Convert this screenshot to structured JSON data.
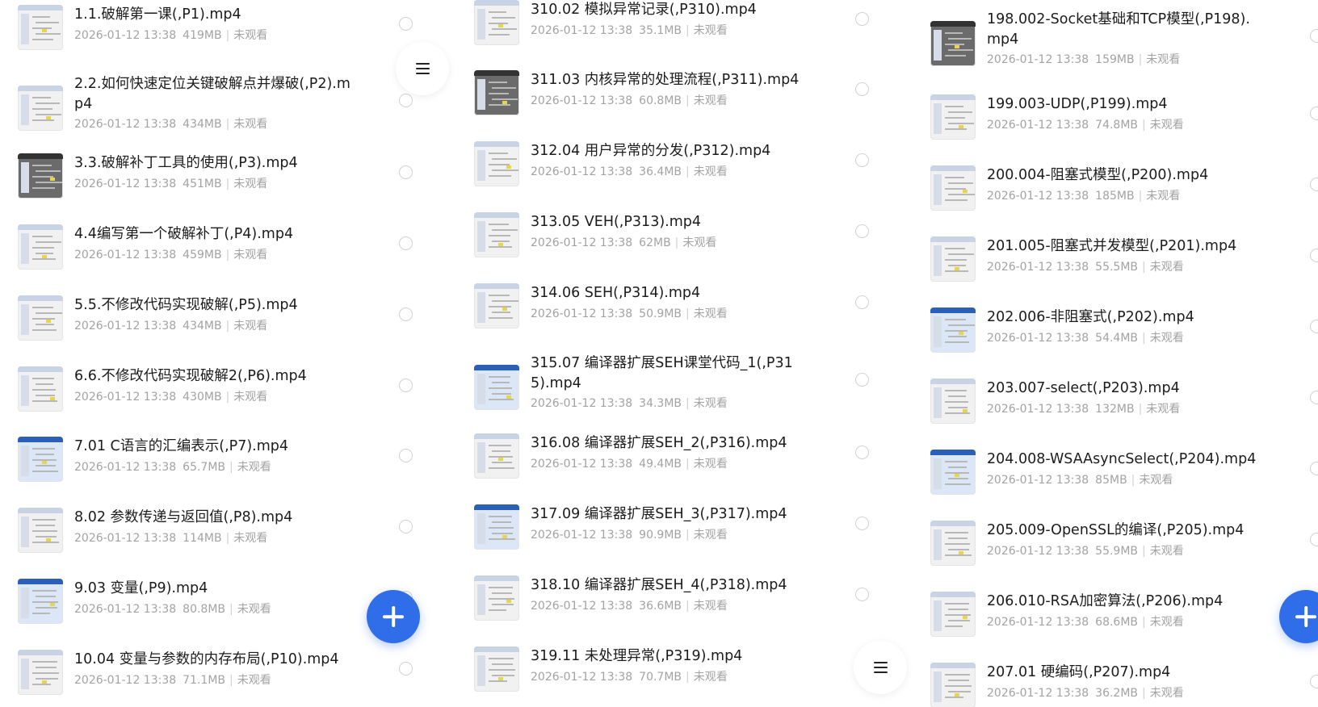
{
  "columns": [
    {
      "name": "col-a",
      "items": [
        {
          "title": "1.1.破解第一课(,P1).mp4",
          "date": "2026-01-12 13:38",
          "size": "419MB",
          "status": "未观看"
        },
        {
          "title": "2.2.如何快速定位关键破解点并爆破(,P2).mp4",
          "date": "2026-01-12 13:38",
          "size": "434MB",
          "status": "未观看"
        },
        {
          "title": "3.3.破解补丁工具的使用(,P3).mp4",
          "date": "2026-01-12 13:38",
          "size": "451MB",
          "status": "未观看"
        },
        {
          "title": "4.4编写第一个破解补丁(,P4).mp4",
          "date": "2026-01-12 13:38",
          "size": "459MB",
          "status": "未观看"
        },
        {
          "title": "5.5.不修改代码实现破解(,P5).mp4",
          "date": "2026-01-12 13:38",
          "size": "434MB",
          "status": "未观看"
        },
        {
          "title": "6.6.不修改代码实现破解2(,P6).mp4",
          "date": "2026-01-12 13:38",
          "size": "430MB",
          "status": "未观看"
        },
        {
          "title": "7.01 C语言的汇编表示(,P7).mp4",
          "date": "2026-01-12 13:38",
          "size": "65.7MB",
          "status": "未观看"
        },
        {
          "title": "8.02 参数传递与返回值(,P8).mp4",
          "date": "2026-01-12 13:38",
          "size": "114MB",
          "status": "未观看"
        },
        {
          "title": "9.03 变量(,P9).mp4",
          "date": "2026-01-12 13:38",
          "size": "80.8MB",
          "status": "未观看"
        },
        {
          "title": "10.04 变量与参数的内存布局(,P10).mp4",
          "date": "2026-01-12 13:38",
          "size": "71.1MB",
          "status": "未观看"
        }
      ]
    },
    {
      "name": "col-b",
      "items": [
        {
          "title": "310.02 模拟异常记录(,P310).mp4",
          "date": "2026-01-12 13:38",
          "size": "35.1MB",
          "status": "未观看"
        },
        {
          "title": "311.03 内核异常的处理流程(,P311).mp4",
          "date": "2026-01-12 13:38",
          "size": "60.8MB",
          "status": "未观看"
        },
        {
          "title": "312.04 用户异常的分发(,P312).mp4",
          "date": "2026-01-12 13:38",
          "size": "36.4MB",
          "status": "未观看"
        },
        {
          "title": "313.05 VEH(,P313).mp4",
          "date": "2026-01-12 13:38",
          "size": "62MB",
          "status": "未观看"
        },
        {
          "title": "314.06 SEH(,P314).mp4",
          "date": "2026-01-12 13:38",
          "size": "50.9MB",
          "status": "未观看"
        },
        {
          "title": "315.07 编译器扩展SEH课堂代码_1(,P315).mp4",
          "date": "2026-01-12 13:38",
          "size": "34.3MB",
          "status": "未观看"
        },
        {
          "title": "316.08 编译器扩展SEH_2(,P316).mp4",
          "date": "2026-01-12 13:38",
          "size": "49.4MB",
          "status": "未观看"
        },
        {
          "title": "317.09 编译器扩展SEH_3(,P317).mp4",
          "date": "2026-01-12 13:38",
          "size": "90.9MB",
          "status": "未观看"
        },
        {
          "title": "318.10 编译器扩展SEH_4(,P318).mp4",
          "date": "2026-01-12 13:38",
          "size": "36.6MB",
          "status": "未观看"
        },
        {
          "title": "319.11 未处理异常(,P319).mp4",
          "date": "2026-01-12 13:38",
          "size": "70.7MB",
          "status": "未观看"
        }
      ]
    },
    {
      "name": "col-c",
      "items": [
        {
          "title": "198.002-Socket基础和TCP模型(,P198).mp4",
          "date": "2026-01-12 13:38",
          "size": "159MB",
          "status": "未观看"
        },
        {
          "title": "199.003-UDP(,P199).mp4",
          "date": "2026-01-12 13:38",
          "size": "74.8MB",
          "status": "未观看"
        },
        {
          "title": "200.004-阻塞式模型(,P200).mp4",
          "date": "2026-01-12 13:38",
          "size": "185MB",
          "status": "未观看"
        },
        {
          "title": "201.005-阻塞式并发模型(,P201).mp4",
          "date": "2026-01-12 13:38",
          "size": "55.5MB",
          "status": "未观看"
        },
        {
          "title": "202.006-非阻塞式(,P202).mp4",
          "date": "2026-01-12 13:38",
          "size": "54.4MB",
          "status": "未观看"
        },
        {
          "title": "203.007-select(,P203).mp4",
          "date": "2026-01-12 13:38",
          "size": "132MB",
          "status": "未观看"
        },
        {
          "title": "204.008-WSAAsyncSelect(,P204).mp4",
          "date": "2026-01-12 13:38",
          "size": "85MB",
          "status": "未观看"
        },
        {
          "title": "205.009-OpenSSL的编译(,P205).mp4",
          "date": "2026-01-12 13:38",
          "size": "55.9MB",
          "status": "未观看"
        },
        {
          "title": "206.010-RSA加密算法(,P206).mp4",
          "date": "2026-01-12 13:38",
          "size": "68.6MB",
          "status": "未观看"
        },
        {
          "title": "207.01 硬编码(,P207).mp4",
          "date": "2026-01-12 13:38",
          "size": "36.2MB",
          "status": "未观看"
        }
      ]
    }
  ],
  "icons": {
    "menu": "hamburger-menu-icon",
    "add": "plus-icon",
    "select": "radio-circle-icon",
    "thumbnail": "video-thumbnail"
  },
  "colors": {
    "accent": "#2f6ee8",
    "title_text": "#1c1c1c",
    "meta_text": "#a3a3a3"
  }
}
